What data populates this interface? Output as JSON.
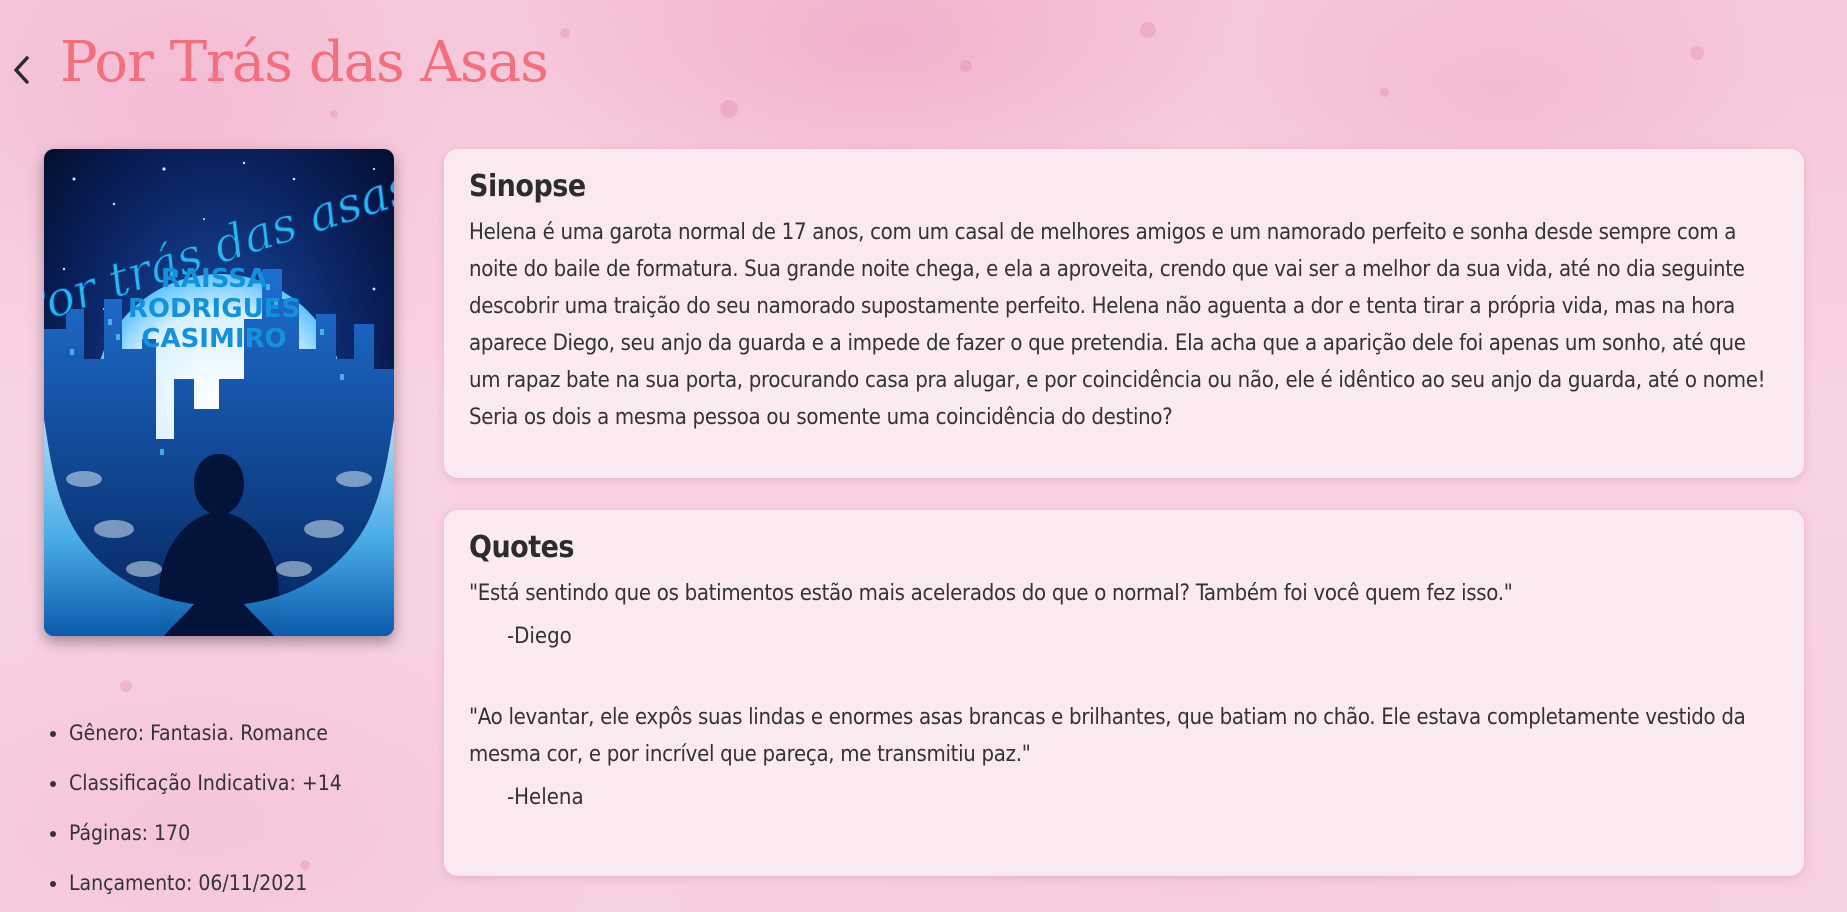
{
  "header": {
    "back_icon": "chevron-left-icon",
    "title": "Por Trás das Asas"
  },
  "cover": {
    "title_text": "Por trás das asas",
    "author_line1": "RAISSA",
    "author_line2": "RODRIGUES",
    "author_line3": "CASIMIRO",
    "colors": {
      "primary": "#1aa9e8",
      "dark": "#04133a",
      "moon": "#e8f6ff"
    }
  },
  "info": {
    "items": [
      "Gênero: Fantasia. Romance",
      "Classificação Indicativa: +14",
      "Páginas: 170",
      "Lançamento: 06/11/2021"
    ]
  },
  "synopsis": {
    "title": "Sinopse",
    "text": "Helena é uma garota normal de 17 anos, com um casal de melhores amigos e um namorado perfeito e sonha desde sempre com a noite do baile de formatura. Sua grande noite chega, e ela a aproveita, crendo que vai ser a melhor da sua vida, até no dia seguinte descobrir uma traição do seu namorado supostamente perfeito. Helena não aguenta a dor e tenta tirar a própria vida, mas na hora aparece Diego, seu anjo da guarda e a impede de fazer o que pretendia. Ela acha que a aparição dele foi apenas um sonho, até que um rapaz bate na sua porta, procurando casa pra alugar, e por coincidência ou não, ele é idêntico ao seu anjo da guarda, até o nome! Seria os dois a mesma pessoa ou somente uma coincidência do destino?"
  },
  "quotes": {
    "title": "Quotes",
    "items": [
      {
        "text": "\"Está sentindo que os batimentos estão mais acelerados do que o normal? Também foi você quem fez isso.\"",
        "author": "-Diego"
      },
      {
        "text": "\"Ao levantar, ele expôs suas lindas e enormes asas brancas e brilhantes, que batiam no chão. Ele estava completamente vestido da mesma cor, e por incrível que pareça, me transmitiu paz.\"",
        "author": "-Helena"
      }
    ]
  },
  "theme": {
    "title_color": "#f26f7d",
    "card_bg": "#fcedf3",
    "background": "#f7cde0"
  }
}
